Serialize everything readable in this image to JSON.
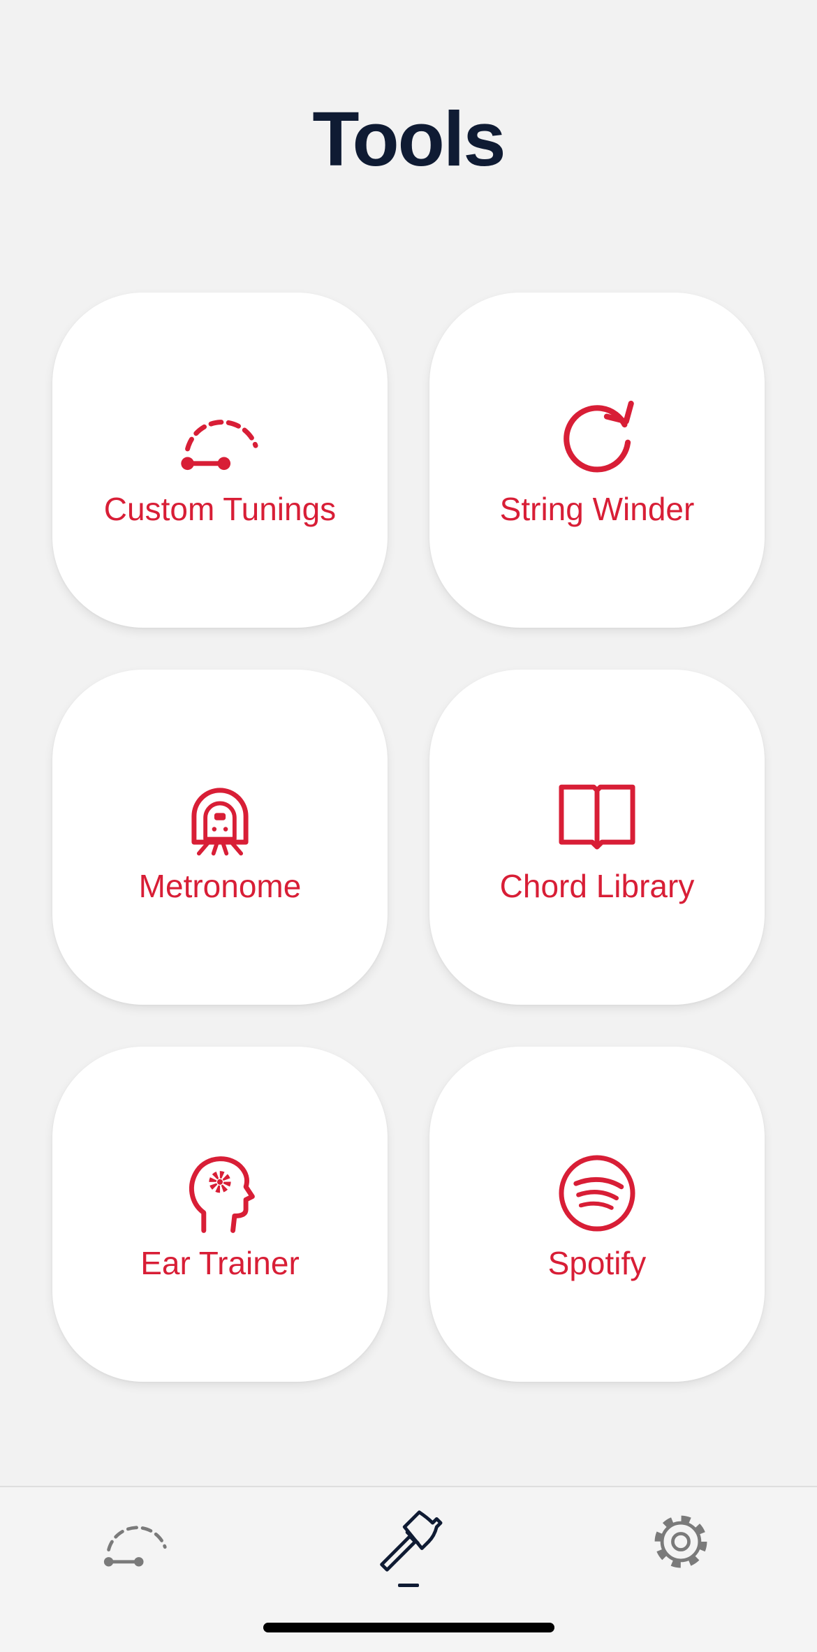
{
  "header": {
    "title": "Tools"
  },
  "tiles": [
    {
      "label": "Custom Tunings",
      "icon": "tuning-gauge-icon"
    },
    {
      "label": "String Winder",
      "icon": "rotate-clockwise-icon"
    },
    {
      "label": "Metronome",
      "icon": "metronome-icon"
    },
    {
      "label": "Chord Library",
      "icon": "open-book-icon"
    },
    {
      "label": "Ear Trainer",
      "icon": "head-gear-icon"
    },
    {
      "label": "Spotify",
      "icon": "spotify-icon"
    }
  ],
  "tab_bar": {
    "tabs": [
      {
        "icon": "tuning-gauge-icon",
        "active": false
      },
      {
        "icon": "hammer-icon",
        "active": true
      },
      {
        "icon": "gear-icon",
        "active": false
      }
    ]
  },
  "colors": {
    "accent": "#d81e36",
    "title": "#0f1b33",
    "background": "#f2f2f2",
    "tile_background": "#ffffff",
    "inactive_tab_icon": "#7a7a7a"
  }
}
